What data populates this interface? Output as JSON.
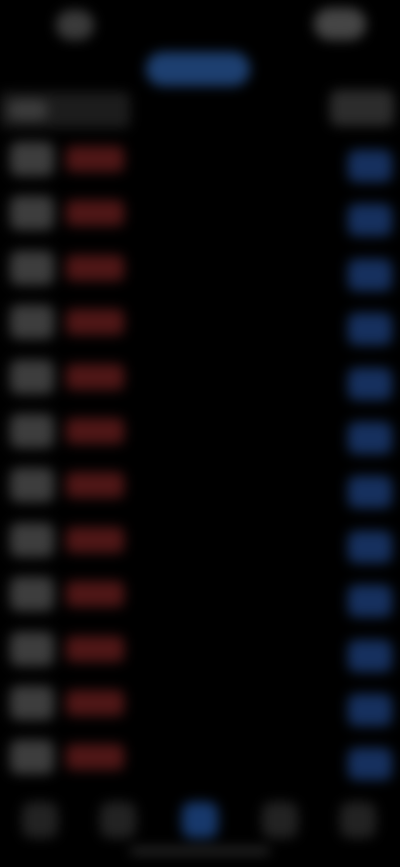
{
  "app": {
    "title": ""
  },
  "left_column": {
    "rows": [
      {
        "index": 1
      },
      {
        "index": 2
      },
      {
        "index": 3
      },
      {
        "index": 4
      },
      {
        "index": 5
      },
      {
        "index": 6
      },
      {
        "index": 7
      },
      {
        "index": 8
      },
      {
        "index": 9
      },
      {
        "index": 10
      },
      {
        "index": 11
      },
      {
        "index": 12
      }
    ]
  },
  "right_column": {
    "rows": [
      {
        "index": 1
      },
      {
        "index": 2
      },
      {
        "index": 3
      },
      {
        "index": 4
      },
      {
        "index": 5
      },
      {
        "index": 6
      },
      {
        "index": 7
      },
      {
        "index": 8
      },
      {
        "index": 9
      },
      {
        "index": 10
      },
      {
        "index": 11
      },
      {
        "index": 12
      }
    ]
  },
  "bottom_nav": {
    "items": [
      {
        "icon": "tab-icon-1",
        "active": false
      },
      {
        "icon": "tab-icon-2",
        "active": false
      },
      {
        "icon": "tab-icon-3",
        "active": true
      },
      {
        "icon": "tab-icon-4",
        "active": false
      },
      {
        "icon": "tab-icon-5",
        "active": false
      }
    ]
  },
  "colors": {
    "background": "#000000",
    "accent_blue": "#1d3f70",
    "accent_red": "#4e1616",
    "neutral": "#3d3d3d"
  }
}
